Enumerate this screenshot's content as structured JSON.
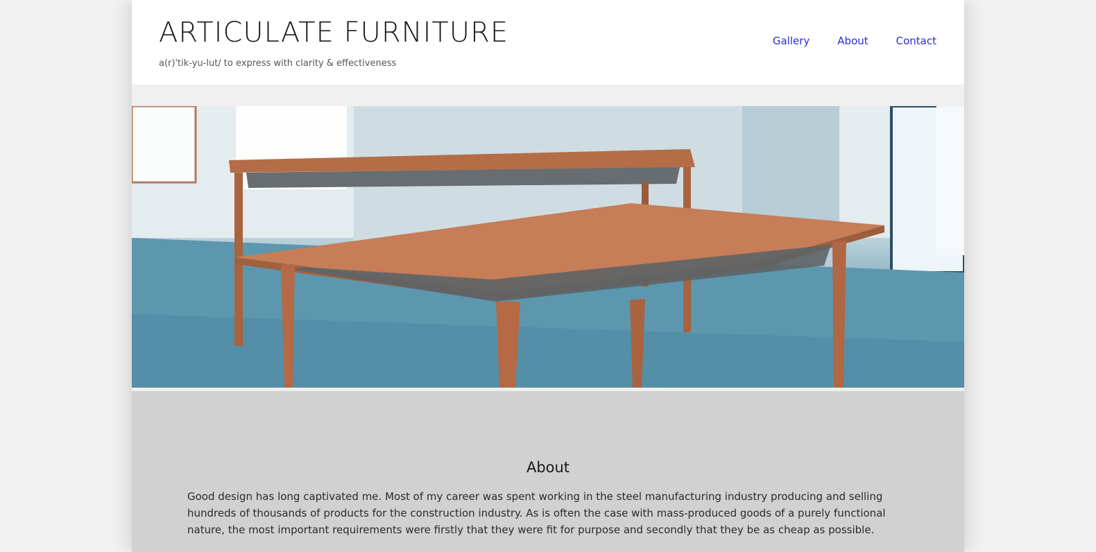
{
  "site": {
    "title": "ARTICULATE FURNITURE",
    "tagline": "a(r)'tik-yu-lut/ to express with clarity & effectiveness"
  },
  "nav": {
    "items": [
      {
        "label": "Gallery"
      },
      {
        "label": "About"
      },
      {
        "label": "Contact"
      }
    ]
  },
  "about": {
    "heading": "About",
    "body": "Good design has long captivated me. Most of my career was spent working in the steel manufacturing industry producing and selling hundreds of thousands of products for the construction industry. As is often the case with mass-produced goods of a purely functional nature, the most important requirements were firstly that they were fit for purpose and secondly that they be as cheap as possible."
  },
  "colors": {
    "nav_link": "#2a2ad6",
    "about_bg": "#d1d1d1",
    "header_bg": "#ffffff"
  }
}
